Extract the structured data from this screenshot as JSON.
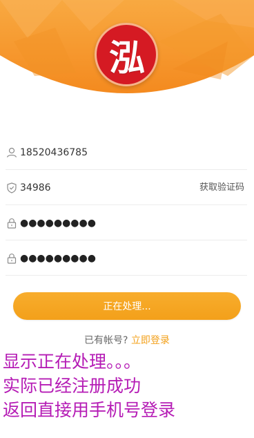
{
  "header": {
    "logo_text": "泓",
    "colors": {
      "orange_top": "#F7A43A",
      "orange_bottom": "#F58C1F",
      "logo_red": "#D51A23"
    }
  },
  "form": {
    "phone": {
      "icon": "user-icon",
      "value": "18520436785"
    },
    "code": {
      "icon": "shield-check-icon",
      "value": "34986",
      "get_code_label": "获取验证码"
    },
    "password": {
      "icon": "lock-icon",
      "value": "●●●●●●●●●"
    },
    "confirm_password": {
      "icon": "lock-icon",
      "value": "●●●●●●●●●"
    }
  },
  "submit_button": {
    "label": "正在处理...",
    "color": "#F3A01A"
  },
  "account_prompt": {
    "text": "已有帐号?",
    "link_label": "立即登录"
  },
  "annotations": [
    "显示正在处理。。。",
    "实际已经注册成功",
    "返回直接用手机号登录"
  ]
}
